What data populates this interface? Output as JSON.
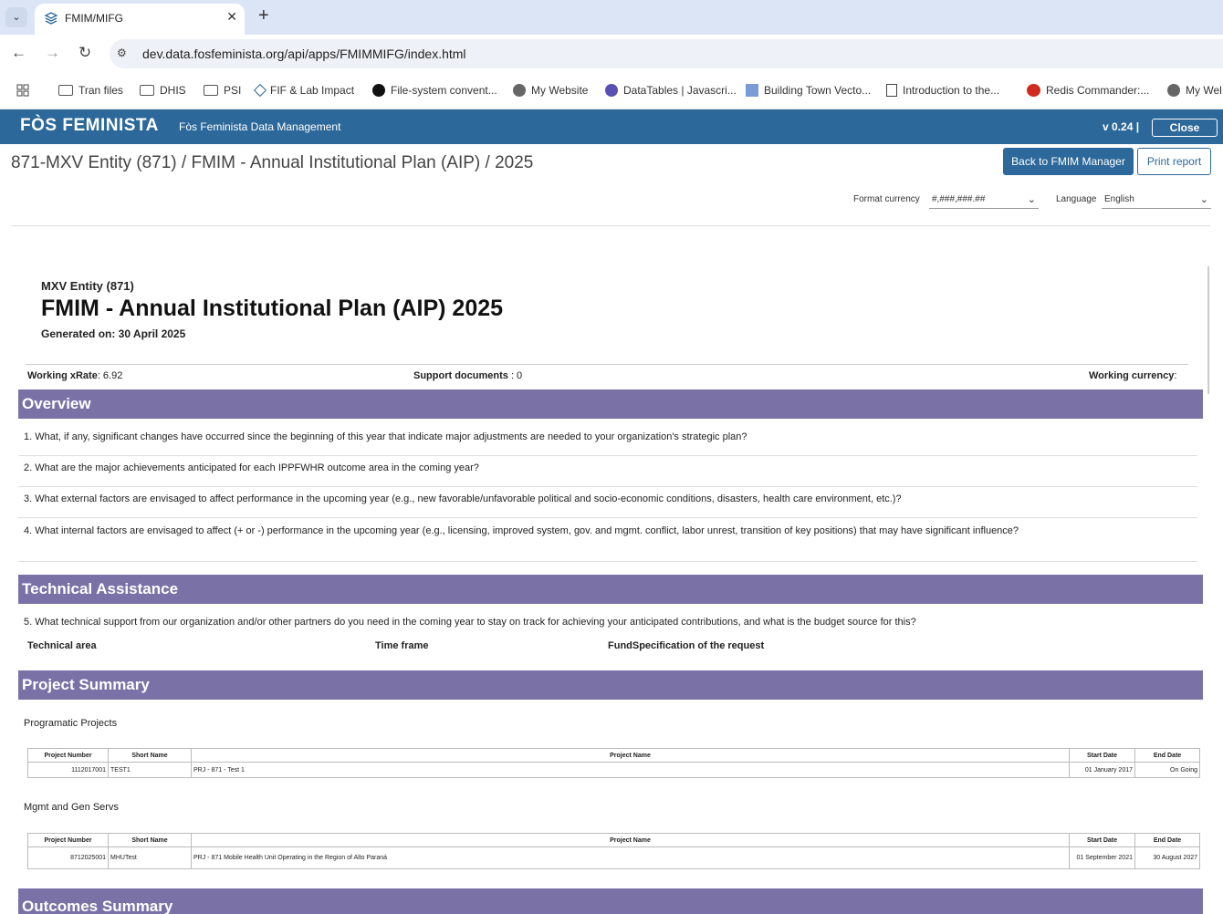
{
  "browser": {
    "tab_title": "FMIM/MIFG",
    "url": "dev.data.fosfeminista.org/api/apps/FMIMMIFG/index.html",
    "bookmarks": [
      "Tran files",
      "DHIS",
      "PSI",
      "FIF & Lab Impact",
      "File-system convent...",
      "My Website",
      "DataTables | Javascri...",
      "Building Town Vecto...",
      "Introduction to the...",
      "Redis Commander:...",
      "My Wel"
    ]
  },
  "app": {
    "logo": "FÒS FEMINISTA",
    "title": "Fòs Feminista Data Management",
    "version": "v 0.24 |",
    "close_label": "Close"
  },
  "page": {
    "breadcrumb": "871-MXV Entity (871) / FMIM - Annual Institutional Plan (AIP) / 2025",
    "back_label": "Back to FMIM Manager",
    "print_label": "Print report",
    "format_currency_label": "Format currency",
    "format_currency_value": "#,###,###.##",
    "language_label": "Language",
    "language_value": "English"
  },
  "report": {
    "entity": "MXV Entity (871)",
    "title": "FMIM - Annual Institutional Plan (AIP)  2025",
    "generated": "Generated on: 30 April 2025",
    "xrate_label": "Working xRate",
    "xrate_value": ": 6.92",
    "support_docs_label": "Support documents",
    "support_docs_value": " : 0",
    "working_currency_label": "Working currency",
    "working_currency_value": ":"
  },
  "overview": {
    "heading": "Overview",
    "questions": [
      "1. What, if any, significant changes have occurred since the beginning of this year that indicate major adjustments are needed to your organization's strategic plan?",
      "2. What are the major achievements anticipated for each IPPFWHR outcome area in the coming year?",
      "3. What external factors are envisaged to affect performance in the upcoming year (e.g., new favorable/unfavorable political and socio-economic conditions, disasters, health care environment, etc.)?",
      "4. What internal factors are envisaged to affect (+ or -) performance in the upcoming year (e.g., licensing, improved system, gov. and mgmt. conflict, labor unrest, transition of key positions) that may have significant influence?"
    ]
  },
  "technical": {
    "heading": "Technical Assistance",
    "question": "5. What technical support from our organization and/or other partners do you need in the coming year to stay on track for achieving your anticipated contributions, and what is the budget source for this?",
    "col_area": "Technical area",
    "col_time": "Time frame",
    "col_fund": "FundSpecification of the request"
  },
  "projects": {
    "heading": "Project Summary",
    "columns": [
      "Project Number",
      "Short Name",
      "Project Name",
      "Start Date",
      "End Date"
    ],
    "programatic_label": "Programatic Projects",
    "programatic_rows": [
      [
        "1112017001",
        "TEST1",
        "PRJ - 871 - Test 1",
        "01 January 2017",
        "On Going"
      ]
    ],
    "mgmt_label": "Mgmt and Gen Servs",
    "mgmt_rows": [
      [
        "8712025001",
        "MHUTest",
        "PRJ - 871 Mobile Health Unit Operating in the Region of Alto Paraná",
        "01 September 2021",
        "30 August 2027"
      ]
    ]
  },
  "outcome": {
    "heading": "Outcomes Summary"
  }
}
